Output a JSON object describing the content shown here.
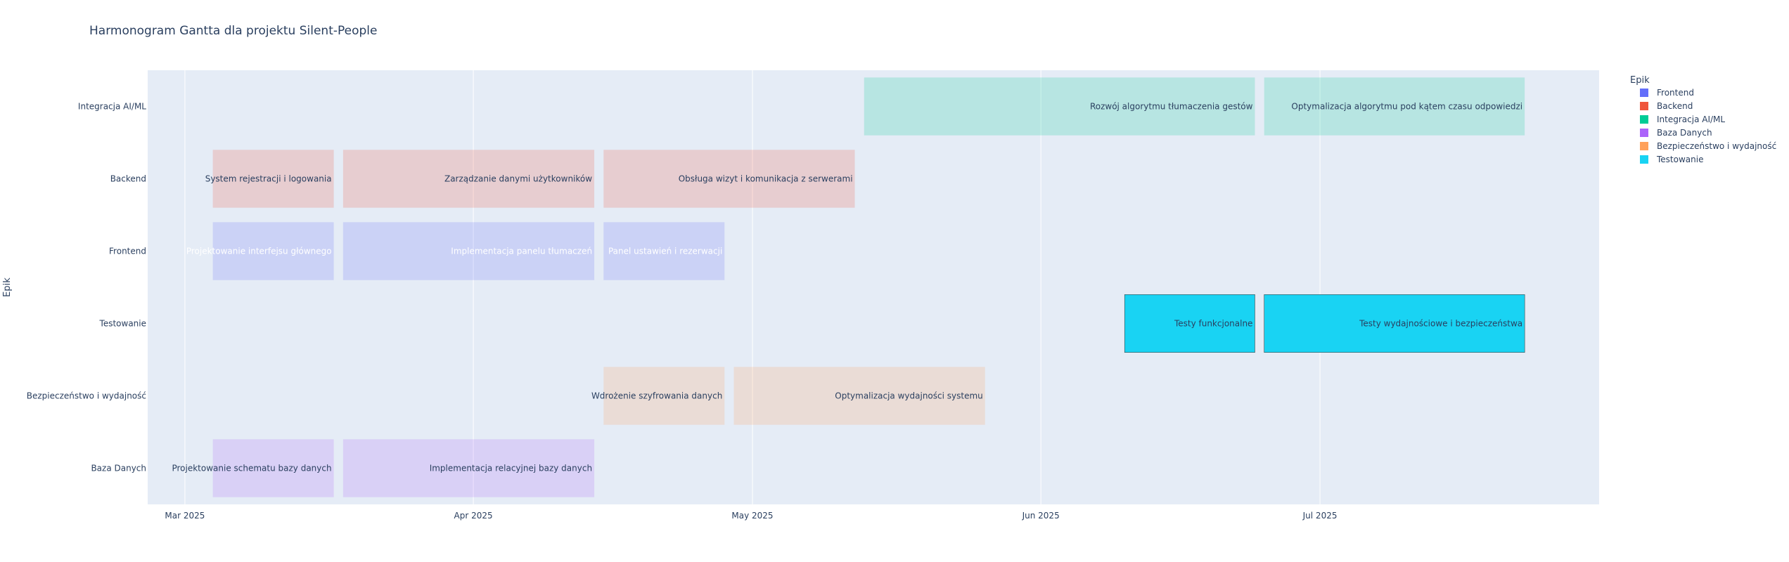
{
  "chart_data": {
    "type": "gantt",
    "title": "Harmonogram Gantta dla projektu Silent-People",
    "ylabel": "Epik",
    "xlabel": "",
    "x_ticks": [
      {
        "date": "2025-03-01",
        "label": "Mar 2025"
      },
      {
        "date": "2025-04-01",
        "label": "Apr 2025"
      },
      {
        "date": "2025-05-01",
        "label": "May 2025"
      },
      {
        "date": "2025-06-01",
        "label": "Jun 2025"
      },
      {
        "date": "2025-07-01",
        "label": "Jul 2025"
      }
    ],
    "xlim": [
      "2025-02-25",
      "2025-07-31"
    ],
    "categories": [
      "Integracja AI/ML",
      "Backend",
      "Frontend",
      "Testowanie",
      "Bezpieczeństwo i wydajność",
      "Baza Danych"
    ],
    "grid": true,
    "legend": {
      "title": "Epik",
      "position": "top-right",
      "entries": [
        "Frontend",
        "Backend",
        "Integracja AI/ML",
        "Baza Danych",
        "Bezpieczeństwo i wydajność",
        "Testowanie"
      ]
    },
    "colors": {
      "Frontend": "#636efa",
      "Backend": "#EF553B",
      "Integracja AI/ML": "#00cc96",
      "Baza Danych": "#ab63fa",
      "Bezpieczeństwo i wydajność": "#FFA15A",
      "Testowanie": "#19d3f3"
    },
    "tasks": [
      {
        "epic": "Integracja AI/ML",
        "name": "Rozwój algorytmu tłumaczenia gestów",
        "start": "2025-05-13",
        "end": "2025-06-24",
        "opacity": 0.2
      },
      {
        "epic": "Integracja AI/ML",
        "name": "Optymalizacja algorytmu pod kątem czasu odpowiedzi",
        "start": "2025-06-25",
        "end": "2025-07-23",
        "opacity": 0.2
      },
      {
        "epic": "Backend",
        "name": "System rejestracji i logowania",
        "start": "2025-03-04",
        "end": "2025-03-17",
        "opacity": 0.2
      },
      {
        "epic": "Backend",
        "name": "Zarządzanie danymi użytkowników",
        "start": "2025-03-18",
        "end": "2025-04-14",
        "opacity": 0.2
      },
      {
        "epic": "Backend",
        "name": "Obsługa wizyt i komunikacja z serwerami",
        "start": "2025-04-15",
        "end": "2025-05-12",
        "opacity": 0.2
      },
      {
        "epic": "Frontend",
        "name": "Projektowanie interfejsu głównego",
        "start": "2025-03-04",
        "end": "2025-03-17",
        "opacity": 0.2
      },
      {
        "epic": "Frontend",
        "name": "Implementacja panelu tłumaczeń",
        "start": "2025-03-18",
        "end": "2025-04-14",
        "opacity": 0.2
      },
      {
        "epic": "Frontend",
        "name": "Panel ustawień i rezerwacji",
        "start": "2025-04-15",
        "end": "2025-04-28",
        "opacity": 0.2
      },
      {
        "epic": "Testowanie",
        "name": "Testy funkcjonalne",
        "start": "2025-06-10",
        "end": "2025-06-24",
        "opacity": 1.0
      },
      {
        "epic": "Testowanie",
        "name": "Testy wydajnościowe i bezpieczeństwa",
        "start": "2025-06-25",
        "end": "2025-07-23",
        "opacity": 1.0
      },
      {
        "epic": "Bezpieczeństwo i wydajność",
        "name": "Wdrożenie szyfrowania danych",
        "start": "2025-04-15",
        "end": "2025-04-28",
        "opacity": 0.2
      },
      {
        "epic": "Bezpieczeństwo i wydajność",
        "name": "Optymalizacja wydajności systemu",
        "start": "2025-04-29",
        "end": "2025-05-26",
        "opacity": 0.2
      },
      {
        "epic": "Baza Danych",
        "name": "Projektowanie schematu bazy danych",
        "start": "2025-03-04",
        "end": "2025-03-17",
        "opacity": 0.2
      },
      {
        "epic": "Baza Danych",
        "name": "Implementacja relacyjnej bazy danych",
        "start": "2025-03-18",
        "end": "2025-04-14",
        "opacity": 0.2
      }
    ]
  }
}
